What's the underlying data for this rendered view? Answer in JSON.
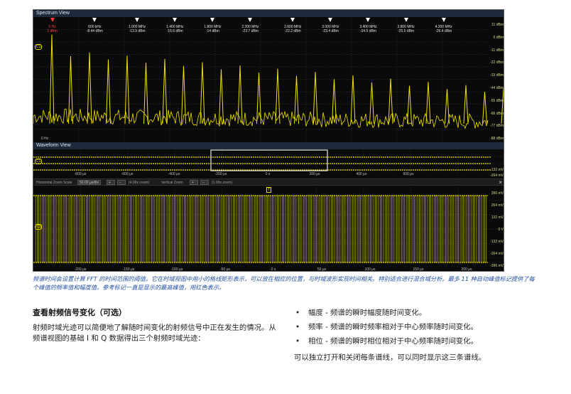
{
  "spectrum": {
    "title": "Spectrum View",
    "markers": [
      {
        "freq": "0 Hz",
        "amp": "1 dBm",
        "ref": true,
        "pos": 0.04
      },
      {
        "freq": "600 kHz",
        "amp": "-8.44 dBm",
        "ref": false,
        "pos": 0.13
      },
      {
        "freq": "1.000 MHz",
        "amp": "-13.9 dBm",
        "ref": false,
        "pos": 0.22
      },
      {
        "freq": "1.400 MHz",
        "amp": "-16.6 dBm",
        "ref": false,
        "pos": 0.3
      },
      {
        "freq": "1.800 MHz",
        "amp": "-14 dBm",
        "ref": false,
        "pos": 0.38
      },
      {
        "freq": "2.200 MHz",
        "amp": "-23.7 dBm",
        "ref": false,
        "pos": 0.46
      },
      {
        "freq": "2.600 MHz",
        "amp": "-22.2 dBm",
        "ref": false,
        "pos": 0.55
      },
      {
        "freq": "3.000 MHz",
        "amp": "-23.4 dBm",
        "ref": false,
        "pos": 0.63
      },
      {
        "freq": "3.400 MHz",
        "amp": "-34.5 dBm",
        "ref": false,
        "pos": 0.71
      },
      {
        "freq": "3.800 MHz",
        "amp": "-25.5 dBm",
        "ref": false,
        "pos": 0.79
      },
      {
        "freq": "4.200 MHz",
        "amp": "-26.4 dBm",
        "ref": false,
        "pos": 0.87
      }
    ],
    "y_labels": [
      "11 dBm",
      "0 dBm",
      "-11 dBm",
      "-22 dBm",
      "-33 dBm",
      "-44 dBm",
      "-55 dBm",
      "-66 dBm",
      "-77 dBm",
      "-88 dBm"
    ],
    "left_label": "0 Hz",
    "channel_label": "C1"
  },
  "waveform": {
    "title": "Waveform View",
    "x_ticks": [
      "-800 μs",
      "-600 μs",
      "-400 μs",
      "-200 μs",
      "0 s",
      "200 μs",
      "400 μs",
      "600 μs"
    ],
    "y_labels": [
      "-132 mV",
      "-264 mV"
    ],
    "channel_label": "C1"
  },
  "zoom_toolbar": {
    "horizontal_label": "Horizontal Zoom Scale",
    "horizontal_value": "50.00 μs/div",
    "horizontal_factor": "(4.00x zoom)",
    "vertical_label": "Vertical Zoom",
    "vertical_factor": "(1.00x zoom)",
    "close_symbol": "×"
  },
  "zoom": {
    "x_ticks": [
      "-200 μs",
      "-150 μs",
      "-100 μs",
      "-50 μs",
      "0 s",
      "50 μs",
      "100 μs",
      "150 μs",
      "200 μs"
    ],
    "y_labels": [
      "396 mV",
      "264 mV",
      "132 mV",
      "0 V",
      "-132 mV",
      "-264 mV",
      "-396 mV"
    ],
    "channel_label": "C1",
    "trigger_label": "T"
  },
  "caption": "频谱时间会设置计算 FFT 的时间范围的阈值。它在时域视图中用小的格线矩形表示，可以放在相应的位置，与时域波形实现时间相关。特别适合进行混合域分析。最多 11 种自动峰值标记提供了每个峰值的频率值和幅度值。参考标记一直是显示的最高峰值，用红色表示。",
  "section": {
    "heading": "查看射频信号变化（可选）",
    "body": "射频时域光迹可以简便地了解随时间变化的射频信号中正在发生的情况。从频谱视图的基础 I 和 Q 数据得出三个射频时域光迹："
  },
  "bullets": [
    "幅度 - 频谱的瞬时幅度随时间变化。",
    "频率 - 频谱的瞬时频率相对于中心频率随时间变化。",
    "相位 - 频谱的瞬时相位相对于中心频率随时间变化。"
  ],
  "bullet_symbol": "•",
  "closing": "可以独立打开和关闭每条谱线，可以同时显示这三条谱线。",
  "colors": {
    "trace": "#f0e200",
    "reference_marker": "#ff3b3b",
    "caption": "#1f4e9c",
    "scope_background": "#0a0a0a"
  }
}
